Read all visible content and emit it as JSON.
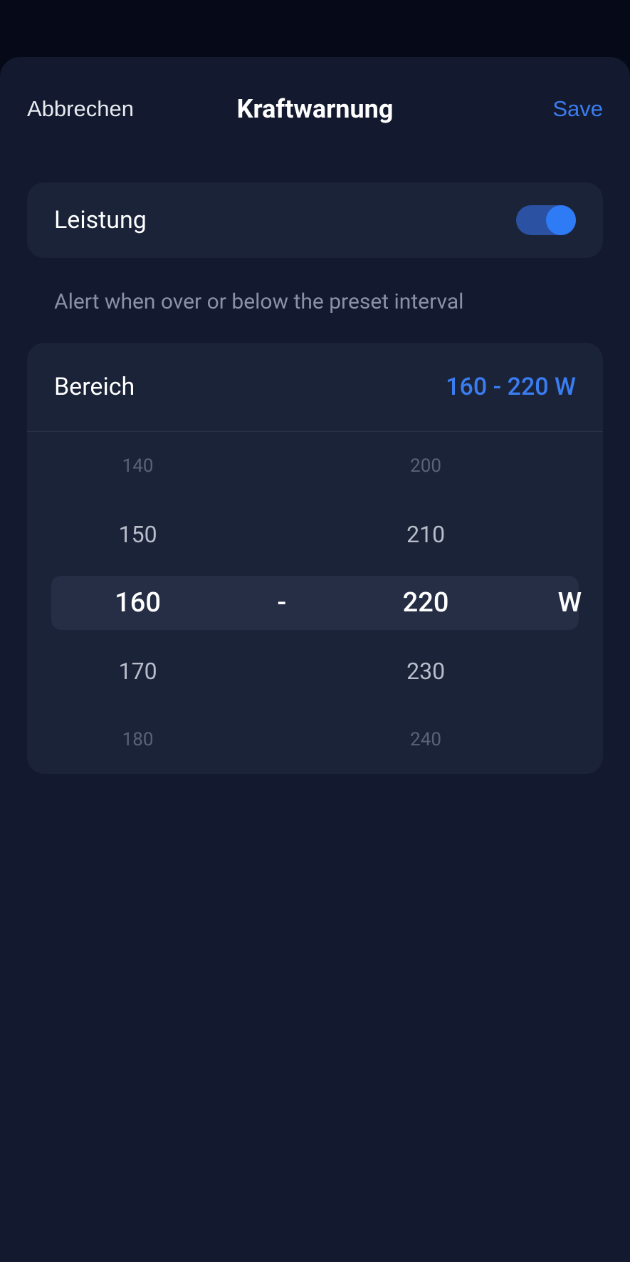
{
  "header": {
    "cancel_label": "Abbrechen",
    "title": "Kraftwarnung",
    "save_label": "Save"
  },
  "toggle": {
    "label": "Leistung",
    "enabled": true
  },
  "description": "Alert when over or below the preset interval",
  "range": {
    "label": "Bereich",
    "value_display": "160 - 220 W",
    "separator": "-",
    "unit": "W",
    "min": {
      "far_above": "140",
      "near_above": "150",
      "selected": "160",
      "near_below": "170",
      "far_below": "180"
    },
    "max": {
      "far_above": "200",
      "near_above": "210",
      "selected": "220",
      "near_below": "230",
      "far_below": "240"
    }
  }
}
